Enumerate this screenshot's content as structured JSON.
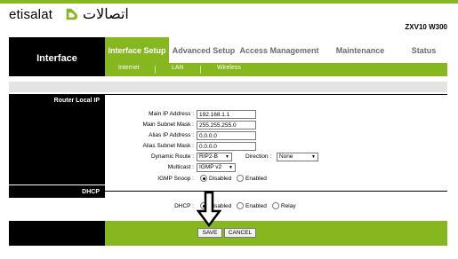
{
  "brand": {
    "latin": "etisalat",
    "arabic": "اتصالات",
    "logo_icon": "etisalat-swirl-icon",
    "accent": "#86b71f"
  },
  "model": "ZXV10 W300",
  "nav": {
    "section_title": "Interface",
    "tabs": [
      {
        "label": "Interface Setup",
        "active": true
      },
      {
        "label": "Advanced Setup",
        "active": false
      },
      {
        "label": "Access Management",
        "active": false
      },
      {
        "label": "Maintenance",
        "active": false
      },
      {
        "label": "Status",
        "active": false
      }
    ],
    "subtabs": [
      "Internet",
      "LAN",
      "Wireless"
    ]
  },
  "router_local_ip": {
    "heading": "Router Local IP",
    "main_ip_label": "Main IP Address :",
    "main_ip_value": "192.168.1.1",
    "main_mask_label": "Main Subnet Mask :",
    "main_mask_value": "255.255.255.0",
    "alias_ip_label": "Alias IP Address :",
    "alias_ip_value": "0.0.0.0",
    "alias_mask_label": "Alias Subnet Mask :",
    "alias_mask_value": "0.0.0.0",
    "dynamic_route_label": "Dynamic Route :",
    "dynamic_route_value": "RIP2-B",
    "direction_label": "Direction :",
    "direction_value": "None",
    "multicast_label": "Multicast :",
    "multicast_value": "IGMP v2",
    "igmp_snoop_label": "IGMP Snoop :",
    "igmp_snoop_options": [
      "Disabled",
      "Enabled"
    ],
    "igmp_snoop_selected": "Disabled"
  },
  "dhcp": {
    "heading": "DHCP",
    "label": "DHCP :",
    "options": [
      "Disabled",
      "Enabled",
      "Relay"
    ],
    "selected": "Disabled"
  },
  "buttons": {
    "save": "SAVE",
    "cancel": "CANCEL"
  },
  "annotation": {
    "icon": "down-arrow-icon"
  }
}
